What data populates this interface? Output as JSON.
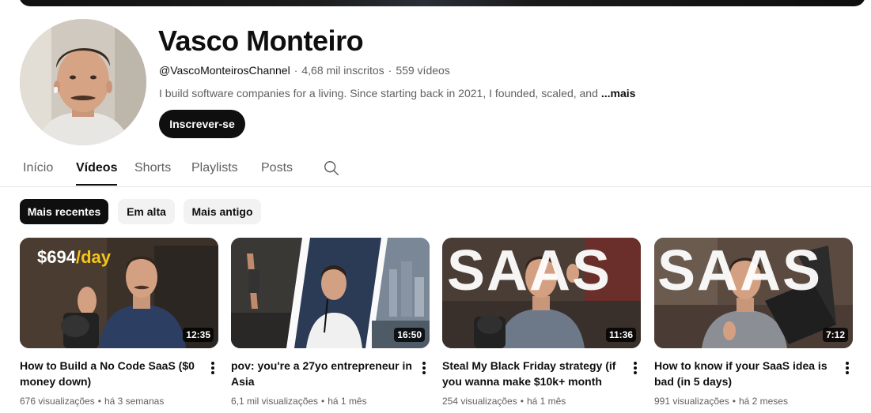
{
  "channel": {
    "name": "Vasco Monteiro",
    "handle": "@VascoMonteirosChannel",
    "subscribers": "4,68 mil inscritos",
    "video_count": "559 vídeos",
    "description": "I build software companies for a living. Since starting back in 2021, I founded, scaled, and",
    "more_label": "...mais",
    "subscribe_label": "Inscrever-se"
  },
  "tabs": [
    {
      "label": "Início"
    },
    {
      "label": "Vídeos"
    },
    {
      "label": "Shorts"
    },
    {
      "label": "Playlists"
    },
    {
      "label": "Posts"
    }
  ],
  "active_tab": "Vídeos",
  "chips": [
    {
      "label": "Mais recentes",
      "active": true
    },
    {
      "label": "Em alta",
      "active": false
    },
    {
      "label": "Mais antigo",
      "active": false
    }
  ],
  "videos": [
    {
      "title": "How to Build a No Code SaaS ($0 money down)",
      "duration": "12:35",
      "views": "676 visualizações",
      "age": "há 3 semanas",
      "thumb_text_a": "$694",
      "thumb_text_b": "/day"
    },
    {
      "title": "pov: you're a 27yo entrepreneur in Asia",
      "duration": "16:50",
      "views": "6,1 mil visualizações",
      "age": "há 1 mês"
    },
    {
      "title": "Steal My Black Friday strategy (if you wanna make $10k+ month wit...",
      "duration": "11:36",
      "views": "254 visualizações",
      "age": "há 1 mês",
      "thumb_text": "SAAS"
    },
    {
      "title": "How to know if your SaaS idea is bad (in 5 days)",
      "duration": "7:12",
      "views": "991 visualizações",
      "age": "há 2 meses",
      "thumb_text": "SAAS"
    }
  ],
  "colors": {
    "text_primary": "#0f0f0f",
    "text_secondary": "#606060",
    "chip_bg": "#f2f2f2",
    "accent_yellow": "#f5c518"
  },
  "icons": {
    "search": "search-icon",
    "menu": "more-vert-icon"
  }
}
